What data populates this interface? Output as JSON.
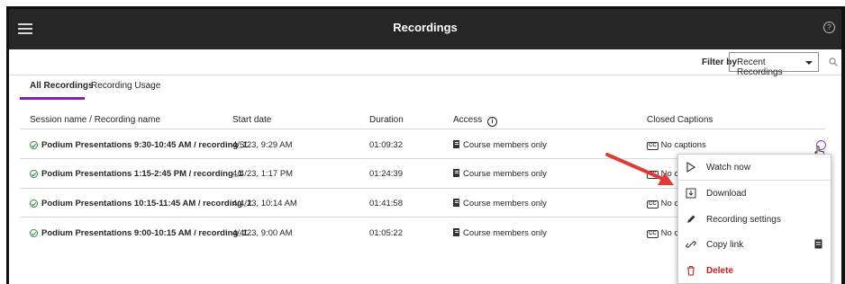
{
  "header": {
    "title": "Recordings"
  },
  "filter": {
    "label": "Filter by",
    "selected": "Recent Recordings"
  },
  "tabs": [
    {
      "label": "All Recordings",
      "active": true
    },
    {
      "label": "Recording Usage",
      "active": false
    }
  ],
  "columns": {
    "name": "Session name / Recording name",
    "start": "Start date",
    "duration": "Duration",
    "access": "Access",
    "captions": "Closed Captions"
  },
  "rows": [
    {
      "name": "Podium Presentations 9:30-10:45 AM / recording_1",
      "start": "4/5/23, 9:29 AM",
      "duration": "01:09:32",
      "access": "Course members only",
      "captions": "No captions"
    },
    {
      "name": "Podium Presentations 1:15-2:45 PM / recording_1",
      "start": "4/4/23, 1:17 PM",
      "duration": "01:24:39",
      "access": "Course members only",
      "captions": "No cap"
    },
    {
      "name": "Podium Presentations 10:15-11:45 AM / recording_1",
      "start": "4/4/23, 10:14 AM",
      "duration": "01:41:58",
      "access": "Course members only",
      "captions": "No cap"
    },
    {
      "name": "Podium Presentations 9:00-10:15 AM / recording_1",
      "start": "4/4/23, 9:00 AM",
      "duration": "01:05:22",
      "access": "Course members only",
      "captions": "No cap"
    }
  ],
  "context_menu": {
    "items": [
      {
        "label": "Watch now",
        "icon": "play-icon"
      },
      {
        "label": "Download",
        "icon": "download-icon"
      },
      {
        "label": "Recording settings",
        "icon": "pencil-icon"
      },
      {
        "label": "Copy link",
        "icon": "link-icon"
      },
      {
        "label": "Delete",
        "icon": "trash-icon"
      }
    ]
  },
  "colors": {
    "accent": "#8a1fb3",
    "header_bg": "#262626",
    "success": "#2e8b3d",
    "danger": "#c41e1e",
    "annotation_arrow": "#e03a36"
  }
}
